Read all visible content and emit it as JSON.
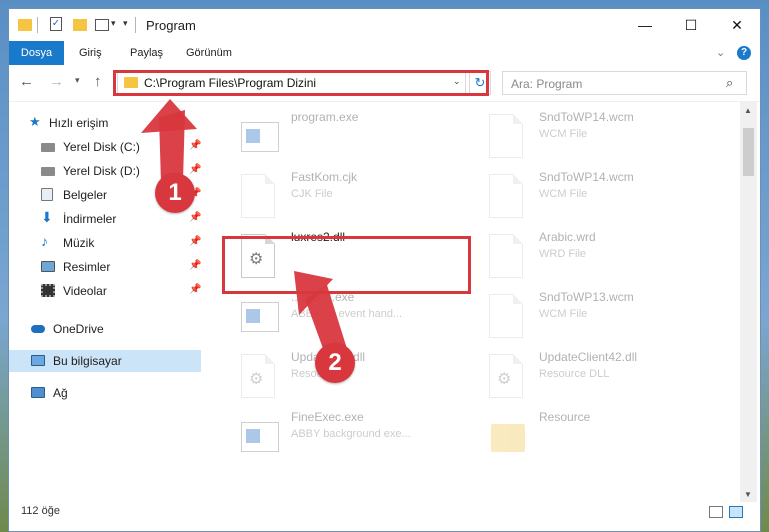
{
  "window": {
    "title": "Program"
  },
  "ribbon": {
    "tabs": [
      "Dosya",
      "Giriş",
      "Paylaş",
      "Görünüm"
    ]
  },
  "address": {
    "path": "C:\\Program Files\\Program Dizini"
  },
  "search": {
    "placeholder": "Ara: Program"
  },
  "nav_pane": {
    "quick_access": "Hızlı erişim",
    "quick_items": [
      "Yerel Disk (C:)",
      "Yerel Disk (D:)",
      "Belgeler",
      "İndirmeler",
      "Müzik",
      "Resimler",
      "Videolar"
    ],
    "onedrive": "OneDrive",
    "this_pc": "Bu bilgisayar",
    "network": "Ağ"
  },
  "files": [
    {
      "name": "program.exe",
      "type": "",
      "icon": "exe-icon"
    },
    {
      "name": "SndToWP14.wcm",
      "type": "WCM File",
      "icon": "document-icon"
    },
    {
      "name": "FastKom.cjk",
      "type": "CJK File",
      "icon": "document-icon"
    },
    {
      "name": "SndToWP14.wcm",
      "type": "WCM File",
      "icon": "document-icon"
    },
    {
      "name": "luxres2.dll",
      "type": "",
      "icon": "dll-gear-icon"
    },
    {
      "name": "Arabic.wrd",
      "type": "WRD File",
      "icon": "document-icon"
    },
    {
      "name": "...yySTI.exe",
      "type": "ABBY db event hand...",
      "icon": "exe-icon"
    },
    {
      "name": "SndToWP13.wcm",
      "type": "WCM File",
      "icon": "document-icon"
    },
    {
      "name": "Update...t5.dll",
      "type": "Resou...",
      "icon": "dll-gear-icon"
    },
    {
      "name": "UpdateClient42.dll",
      "type": "Resource DLL",
      "icon": "dll-gear-icon"
    },
    {
      "name": "FineExec.exe",
      "type": "ABBY background exe...",
      "icon": "exe-icon"
    },
    {
      "name": "Resource",
      "type": "",
      "icon": "folder-icon"
    }
  ],
  "annotations": {
    "step1": "1",
    "step2": "2"
  },
  "status": {
    "count": "112 öğe"
  },
  "colors": {
    "accent": "#1979ca",
    "highlight": "#d9373e"
  }
}
